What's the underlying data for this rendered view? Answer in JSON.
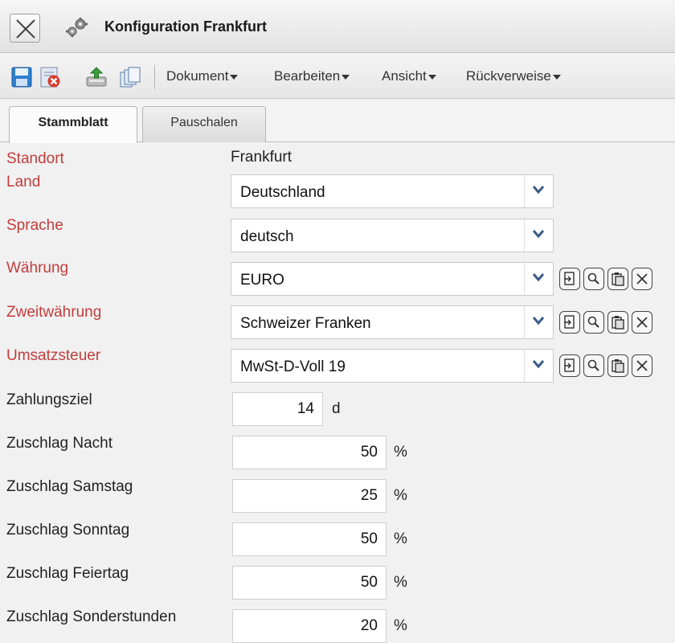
{
  "window": {
    "title": "Konfiguration Frankfurt",
    "close_icon": "close-icon",
    "app_icon": "gears-icon"
  },
  "toolbar": {
    "icons": [
      "save-icon",
      "delete-icon",
      "export-icon",
      "copy-icon"
    ],
    "menus": [
      {
        "label": "Dokument"
      },
      {
        "label": "Bearbeiten"
      },
      {
        "label": "Ansicht"
      },
      {
        "label": "Rückverweise"
      }
    ]
  },
  "tabs": [
    {
      "label": "Stammblatt",
      "active": true
    },
    {
      "label": "Pauschalen",
      "active": false
    }
  ],
  "form": {
    "standort": {
      "label": "Standort",
      "value": "Frankfurt"
    },
    "land": {
      "label": "Land",
      "value": "Deutschland"
    },
    "sprache": {
      "label": "Sprache",
      "value": "deutsch"
    },
    "waehrung": {
      "label": "Währung",
      "value": "EURO"
    },
    "zweitwaehrung": {
      "label": "Zweitwährung",
      "value": "Schweizer Franken"
    },
    "umsatzsteuer": {
      "label": "Umsatzsteuer",
      "value": "MwSt-D-Voll 19"
    },
    "zahlungsziel": {
      "label": "Zahlungsziel",
      "value": "14",
      "unit": "d"
    },
    "zuschlag_nacht": {
      "label": "Zuschlag Nacht",
      "value": "50",
      "unit": "%"
    },
    "zuschlag_samstag": {
      "label": "Zuschlag Samstag",
      "value": "25",
      "unit": "%"
    },
    "zuschlag_sonntag": {
      "label": "Zuschlag Sonntag",
      "value": "50",
      "unit": "%"
    },
    "zuschlag_feiertag": {
      "label": "Zuschlag Feiertag",
      "value": "50",
      "unit": "%"
    },
    "zuschlag_sonderstunden": {
      "label": "Zuschlag Sonderstunden",
      "value": "20",
      "unit": "%"
    }
  },
  "colors": {
    "required_label": "#c33c3c",
    "normal_label": "#222222",
    "background": "#f1f1f1"
  }
}
